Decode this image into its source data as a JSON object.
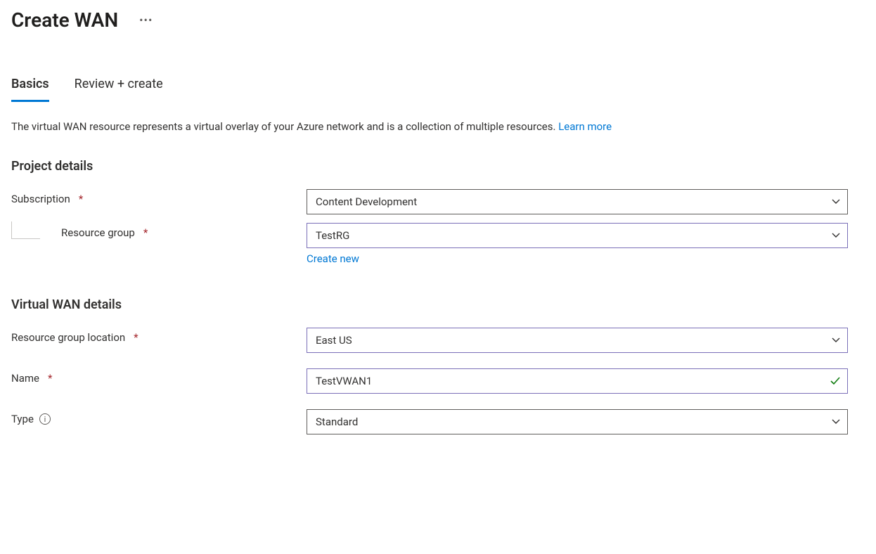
{
  "header": {
    "title": "Create WAN",
    "moreLabel": "More actions"
  },
  "tabs": [
    {
      "label": "Basics",
      "active": true
    },
    {
      "label": "Review + create",
      "active": false
    }
  ],
  "description": {
    "text": "The virtual WAN resource represents a virtual overlay of your Azure network and is a collection of multiple resources.  ",
    "linkLabel": "Learn more"
  },
  "sections": {
    "project": {
      "title": "Project details",
      "subscription": {
        "label": "Subscription",
        "value": "Content Development"
      },
      "resourceGroup": {
        "label": "Resource group",
        "value": "TestRG",
        "createNewLabel": "Create new"
      }
    },
    "wan": {
      "title": "Virtual WAN details",
      "location": {
        "label": "Resource group location",
        "value": "East US"
      },
      "name": {
        "label": "Name",
        "value": "TestVWAN1"
      },
      "type": {
        "label": "Type",
        "value": "Standard"
      }
    }
  }
}
